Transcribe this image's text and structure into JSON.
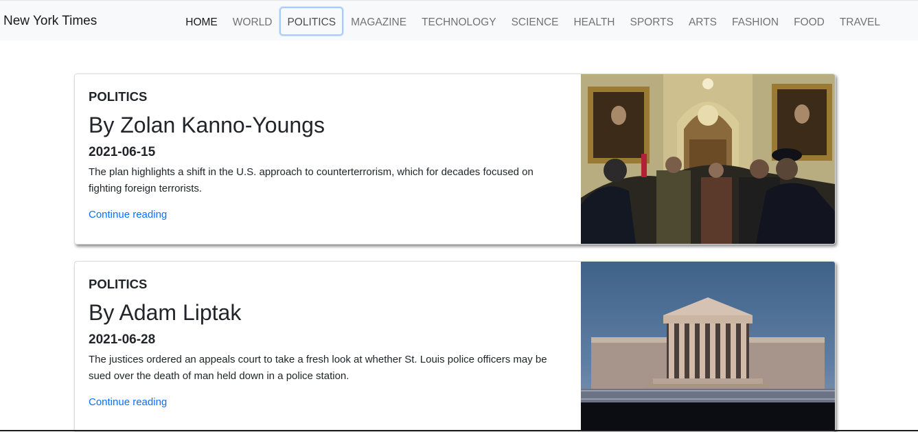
{
  "brand": "New York Times",
  "nav": [
    "HOME",
    "WORLD",
    "POLITICS",
    "MAGAZINE",
    "TECHNOLOGY",
    "SCIENCE",
    "HEALTH",
    "SPORTS",
    "ARTS",
    "FASHION",
    "FOOD",
    "TRAVEL"
  ],
  "active_nav": "HOME",
  "focused_nav": "POLITICS",
  "articles": [
    {
      "section": "POLITICS",
      "byline": "By Zolan Kanno-Youngs",
      "date": "2021-06-15",
      "summary": "The plan highlights a shift in the U.S. approach to counterterrorism, which for decades focused on fighting foreign terrorists.",
      "link": "Continue reading"
    },
    {
      "section": "POLITICS",
      "byline": "By Adam Liptak",
      "date": "2021-06-28",
      "summary": "The justices ordered an appeals court to take a fresh look at whether St. Louis police officers may be sued over the death of man held down in a police station.",
      "link": "Continue reading"
    }
  ],
  "colors": {
    "link": "#0d6efd",
    "navbar_bg": "#f8f9fa",
    "focus_ring": "#a9cdf2"
  }
}
